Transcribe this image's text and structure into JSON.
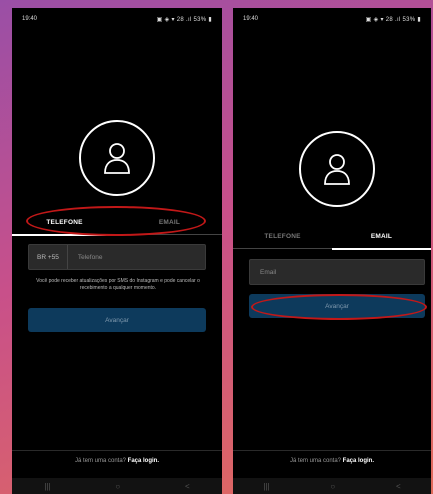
{
  "left_screen": {
    "status_time": "19:40",
    "status_right": "▣ ◈ ▾ 28 .ıl 53% ▮",
    "tabs": {
      "phone": "TELEFONE",
      "email": "EMAIL"
    },
    "country_code": "BR +55",
    "phone_placeholder": "Telefone",
    "hint": "Você pode receber atualizações por SMS do Instagram e pode cancelar o recebimento a qualquer momento.",
    "next_button": "Avançar",
    "footer_text": "Já tem uma conta?",
    "footer_link": "Faça login."
  },
  "right_screen": {
    "status_time": "19:40",
    "status_right": "▣ ◈ ▾ 28 .ıl 53% ▮",
    "tabs": {
      "phone": "TELEFONE",
      "email": "EMAIL"
    },
    "email_placeholder": "Email",
    "next_button": "Avançar",
    "footer_text": "Já tem uma conta?",
    "footer_link": "Faça login."
  },
  "navbar": {
    "recent": "|||",
    "home": "○",
    "back": "<"
  },
  "colors": {
    "annotation": "#c21818",
    "button": "#0d3a5c"
  }
}
